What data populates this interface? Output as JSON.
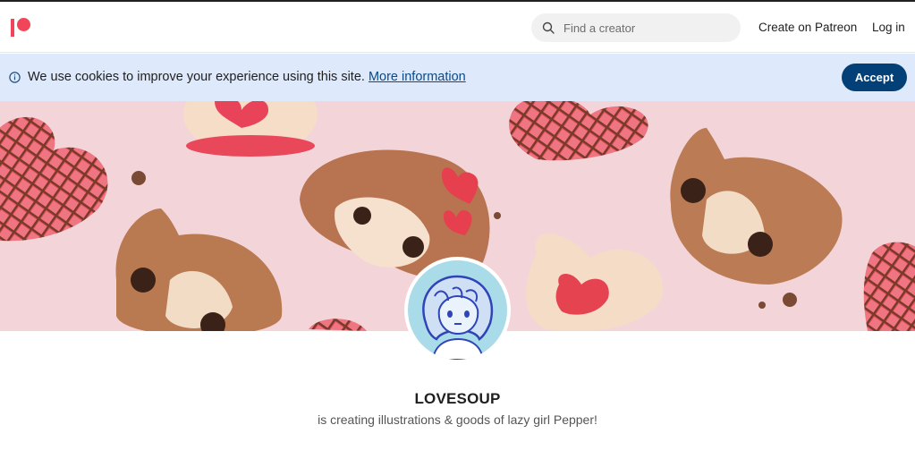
{
  "header": {
    "logo": "patreon-logo",
    "search": {
      "placeholder": "Find a creator",
      "icon": "search-icon"
    },
    "create_label": "Create on Patreon",
    "login_label": "Log in"
  },
  "cookie_banner": {
    "icon": "info-icon",
    "message": "We use cookies to improve your experience using this site.",
    "link_label": "More information",
    "accept_label": "Accept"
  },
  "creator": {
    "name": "LOVESOUP",
    "tagline": "is creating illustrations & goods of lazy girl Pepper!"
  },
  "colors": {
    "brand": "#f1465a",
    "accept_button": "#024077",
    "cookie_bg": "#deeafb",
    "banner_bg": "#f3d5d9"
  }
}
